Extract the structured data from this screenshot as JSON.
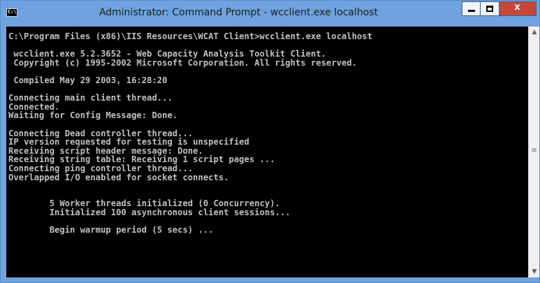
{
  "window": {
    "title": "Administrator: Command Prompt - wcclient.exe  localhost",
    "app_icon": "cmd-icon",
    "app_icon_text": "C:\\",
    "buttons": {
      "minimize": "minimize-icon",
      "maximize": "maximize-icon",
      "close_label": "x"
    },
    "colors": {
      "frame": "#6fa3df",
      "console_bg": "#000000",
      "console_text": "#c0c0c0",
      "close": "#c7463a"
    }
  },
  "console": {
    "lines": [
      "C:\\Program Files (x86)\\IIS Resources\\WCAT Client>wcclient.exe localhost",
      "",
      " wcclient.exe 5.2.3652 - Web Capacity Analysis Toolkit Client.",
      " Copyright (c) 1995-2002 Microsoft Corporation. All rights reserved.",
      "",
      " Compiled May 29 2003, 16:28:20",
      "",
      "Connecting main client thread...",
      "Connected.",
      "Waiting for Config Message: Done.",
      "",
      "Connecting Dead controller thread...",
      "IP version requested for testing is unspecified",
      "Receiving script header message: Done.",
      "Receiving string table: Receiving 1 script pages ...",
      "Connecting ping controller thread...",
      "Overlapped I/O enabled for socket connects.",
      "",
      "",
      "        5 Worker threads initialized (0 Concurrency).",
      "        Initialized 100 asynchronous client sessions...",
      "",
      "        Begin warmup period (5 secs) ..."
    ]
  },
  "scrollbar": {
    "up_icon": "scroll-up-arrow-icon",
    "down_icon": "scroll-down-arrow-icon",
    "thumb_icon": "scroll-grip-icon"
  }
}
